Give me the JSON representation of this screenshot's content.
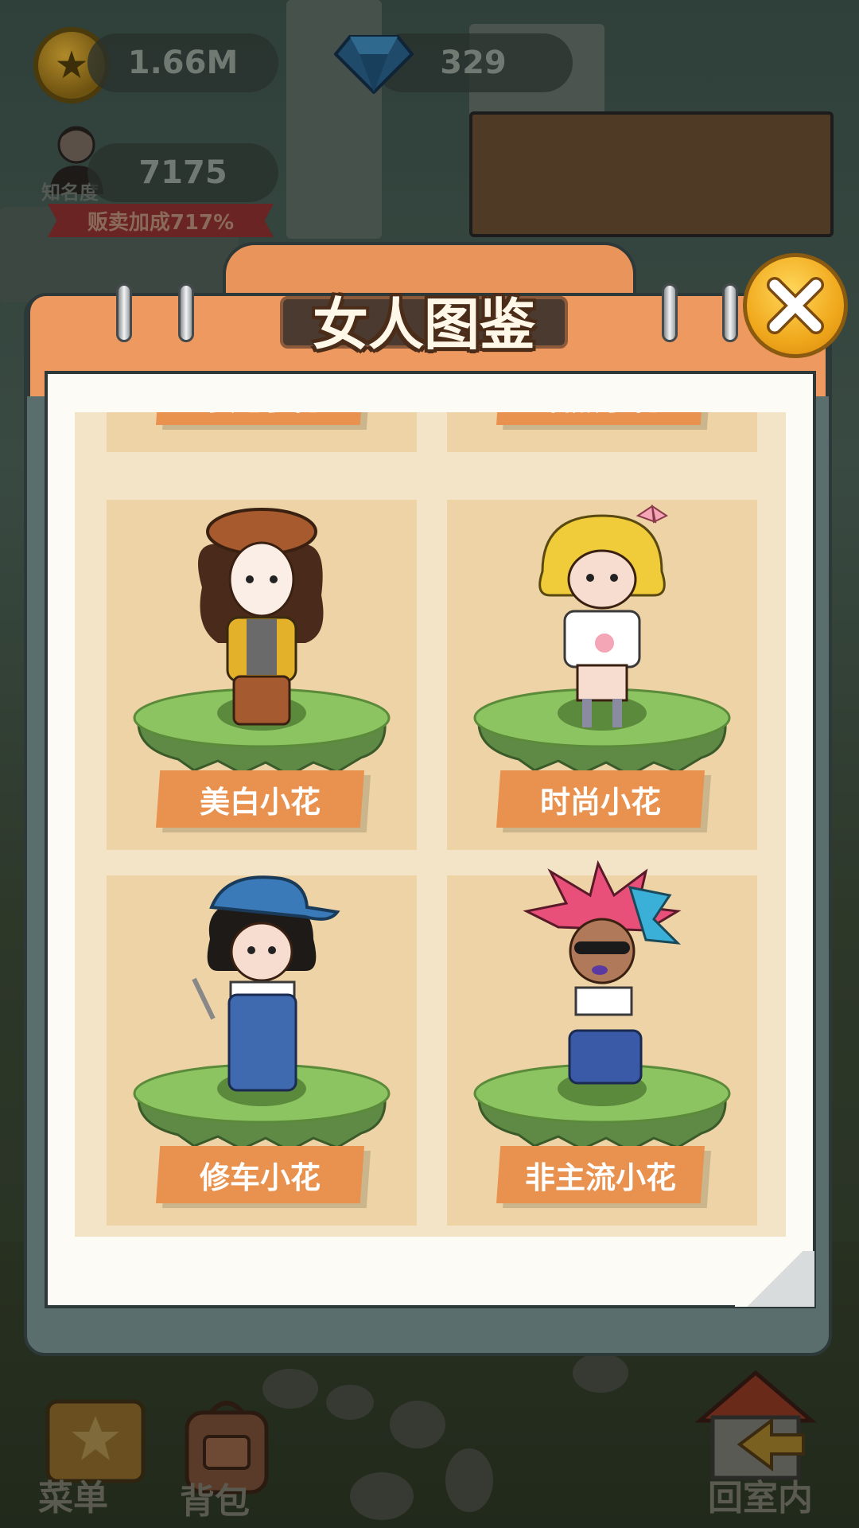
{
  "hud": {
    "coins": "1.66M",
    "gems": "329",
    "fame_label": "知名度",
    "fame_value": "7175",
    "sale_bonus": "贩卖加成717%"
  },
  "modal": {
    "title": "女人图鉴",
    "cards": [
      {
        "name": "泰定小花"
      },
      {
        "name": "晒黑小花"
      },
      {
        "name": "美白小花"
      },
      {
        "name": "时尚小花"
      },
      {
        "name": "修车小花"
      },
      {
        "name": "非主流小花"
      }
    ]
  },
  "bottom_nav": {
    "menu": "菜单",
    "backpack": "背包",
    "return_indoor": "回室内"
  },
  "colors": {
    "header_orange": "#ee9960",
    "label_orange": "#e9914e",
    "card_bg": "#edd3a6",
    "close_gold": "#f0a81c"
  },
  "icons": [
    "coin-icon",
    "gem-icon",
    "fame-avatar-icon",
    "close-icon",
    "menu-book-icon",
    "backpack-icon",
    "house-arrow-icon"
  ]
}
